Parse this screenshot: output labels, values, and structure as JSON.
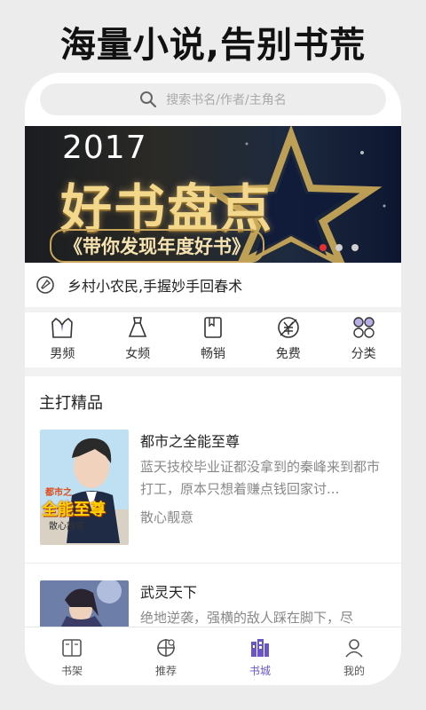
{
  "headline": "海量小说,告别书荒",
  "search": {
    "placeholder": "搜索书名/作者/主角名",
    "icon": "search-icon"
  },
  "banner": {
    "year": "2017",
    "title": "好书盘点",
    "subtitle": "《带你发现年度好书》",
    "slide_count": 3,
    "active_slide": 1
  },
  "notice": {
    "icon": "megaphone-icon",
    "text": "乡村小农民,手握妙手回春术"
  },
  "categories": [
    {
      "label": "男频",
      "icon": "suit-icon"
    },
    {
      "label": "女频",
      "icon": "dress-icon"
    },
    {
      "label": "畅销",
      "icon": "bookmark-book-icon"
    },
    {
      "label": "免费",
      "icon": "free-yen-icon"
    },
    {
      "label": "分类",
      "icon": "grid-icon"
    }
  ],
  "section": {
    "title": "主打精品"
  },
  "books": [
    {
      "name": "都市之全能至尊",
      "desc": "蓝天技校毕业证都没拿到的秦峰来到都市打工，原本只想着赚点钱回家讨...",
      "author": "散心靓意",
      "cover_title": "全能至尊",
      "cover_top": "都市之",
      "cover_author": "散心靓意"
    },
    {
      "name": "武灵天下",
      "desc": "绝地逆袭，强横的敌人踩在脚下，尽",
      "author": "",
      "cover_title": "",
      "cover_top": "",
      "cover_author": ""
    }
  ],
  "tabbar": [
    {
      "label": "书架",
      "icon": "bookshelf-icon"
    },
    {
      "label": "推荐",
      "icon": "recommend-icon"
    },
    {
      "label": "书城",
      "icon": "bookstore-icon",
      "active": true
    },
    {
      "label": "我的",
      "icon": "profile-icon"
    }
  ],
  "colors": {
    "accent": "#6a55c8",
    "dot_active": "#e2322f"
  }
}
